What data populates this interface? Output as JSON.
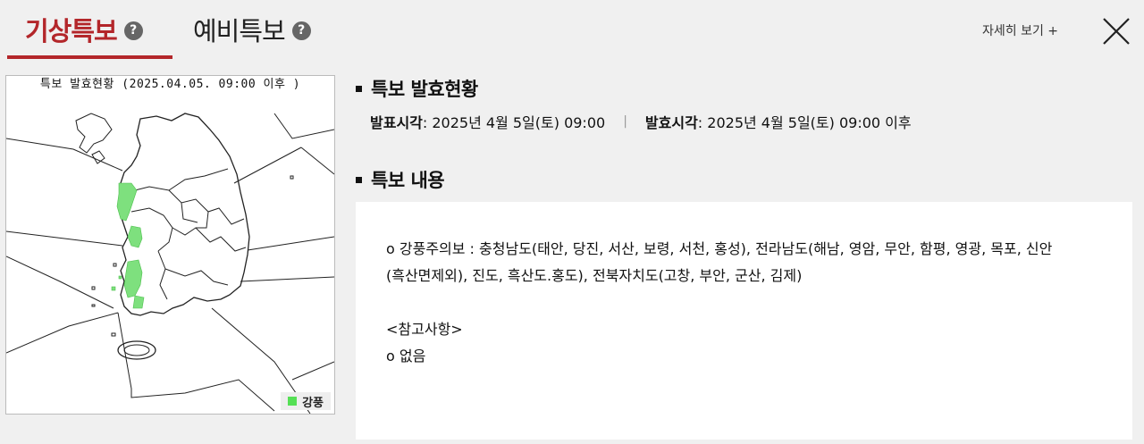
{
  "tabs": [
    {
      "label": "기상특보",
      "active": true
    },
    {
      "label": "예비특보",
      "active": false
    }
  ],
  "help_glyph": "?",
  "more_link": "자세히 보기 +",
  "map": {
    "title": "특보 발효현황 (2025.04.05. 09:00 이후 )",
    "legend_label": "강풍",
    "legend_color": "#55e055"
  },
  "status_section": {
    "heading": "특보 발효현황",
    "announce_label": "발표시각",
    "announce_value": " : 2025년 4월 5일(토) 09:00",
    "separator": "|",
    "effective_label": "발효시각",
    "effective_value": " : 2025년 4월 5일(토) 09:00 이후"
  },
  "content_section": {
    "heading": "특보 내용",
    "line1": "o 강풍주의보 : 충청남도(태안, 당진, 서산, 보령, 서천, 홍성), 전라남도(해남, 영암, 무안, 함평, 영광, 목포, 신안",
    "line2": "(흑산면제외), 진도, 흑산도.홍도), 전북자치도(고창, 부안, 군산, 김제)",
    "note_heading": "<참고사항>",
    "note_value": "o 없음"
  },
  "colors": {
    "accent": "#b3262a",
    "background": "#f0f0f0"
  }
}
